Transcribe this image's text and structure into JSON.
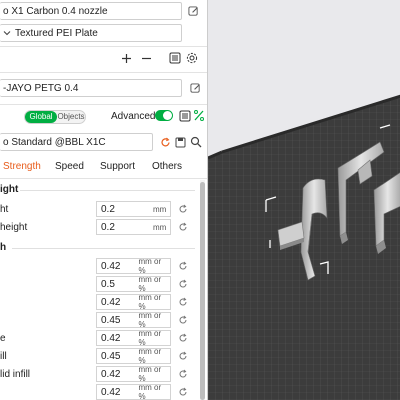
{
  "printer": {
    "name": "o X1 Carbon 0.4 nozzle"
  },
  "plate": {
    "type": "Textured PEI Plate"
  },
  "filament": {
    "name": "-JAYO PETG 0.4"
  },
  "toggle": {
    "global_label": "Global",
    "objects_label": "Objects",
    "advanced_label": "Advanced",
    "advanced_on": true
  },
  "process": {
    "name": "o Standard @BBL X1C"
  },
  "tabs": [
    {
      "label": "Strength",
      "active": true
    },
    {
      "label": "Speed",
      "active": false
    },
    {
      "label": "Support",
      "active": false
    },
    {
      "label": "Others",
      "active": false
    }
  ],
  "sections": {
    "layer_height": {
      "title": "ight",
      "params": [
        {
          "label": "ht",
          "value": "0.2",
          "unit": "mm"
        },
        {
          "label": "height",
          "value": "0.2",
          "unit": "mm"
        }
      ]
    },
    "line_width": {
      "title": "h",
      "params": [
        {
          "label": "",
          "value": "0.42",
          "unit": "mm or %"
        },
        {
          "label": "",
          "value": "0.5",
          "unit": "mm or %"
        },
        {
          "label": "",
          "value": "0.42",
          "unit": "mm or %"
        },
        {
          "label": "",
          "value": "0.45",
          "unit": "mm or %"
        },
        {
          "label": "e",
          "value": "0.42",
          "unit": "mm or %"
        },
        {
          "label": "ill",
          "value": "0.45",
          "unit": "mm or %"
        },
        {
          "label": "lid infill",
          "value": "0.42",
          "unit": "mm or %"
        },
        {
          "label": "",
          "value": "0.42",
          "unit": "mm or %"
        }
      ]
    }
  },
  "colors": {
    "accent": "#00ae42",
    "tab_active": "#e85d1c",
    "viewport_bg": "#e9e9ec",
    "plate": "#3c3c3c"
  },
  "icons": [
    "edit-icon",
    "dropdown-icon",
    "plus-icon",
    "minus-icon",
    "list-icon",
    "settings-icon",
    "reset-icon",
    "save-icon",
    "search-icon",
    "compare-icon",
    "drag-icon"
  ]
}
